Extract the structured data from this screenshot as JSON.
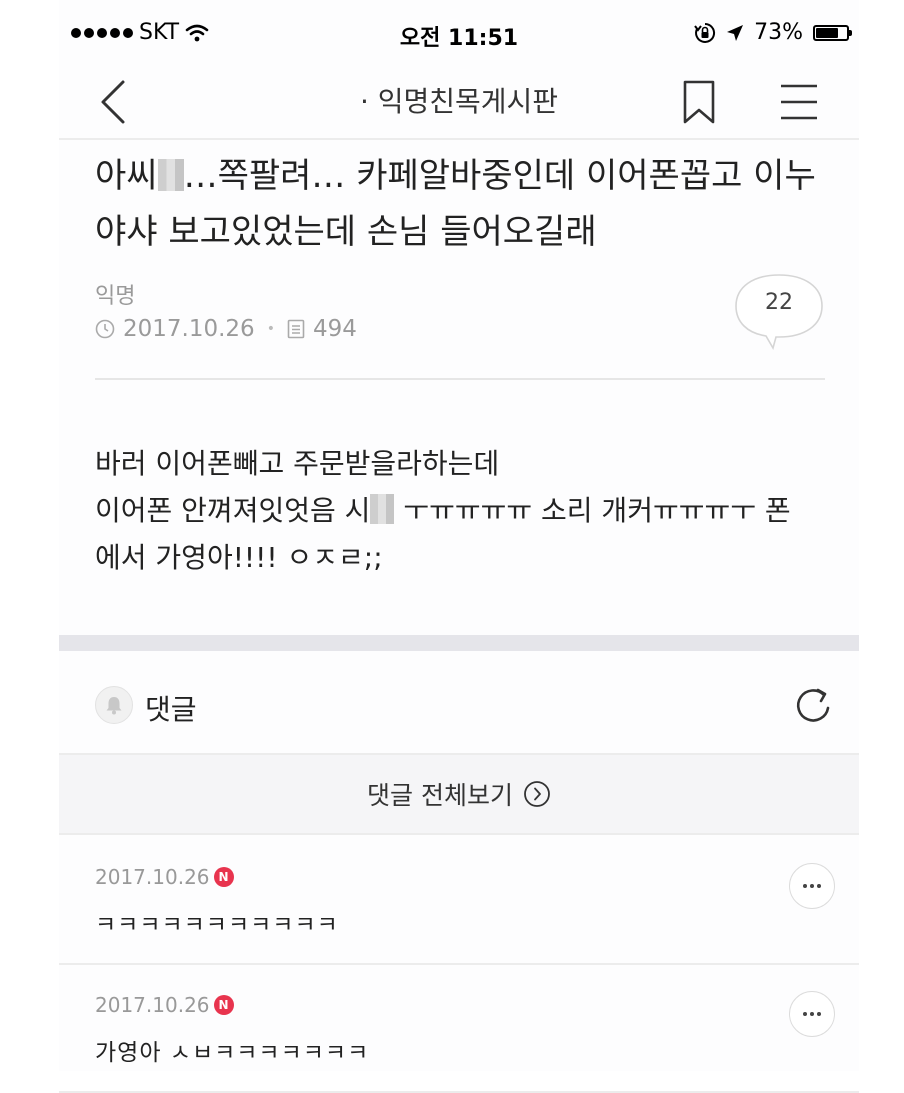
{
  "status_bar": {
    "carrier": "SKT",
    "time": "오전 11:51",
    "battery_percent": "73%",
    "battery_level": 0.73,
    "icons": [
      "signal-dots-icon",
      "wifi-icon",
      "orientation-lock-icon",
      "location-arrow-icon",
      "battery-icon"
    ]
  },
  "nav": {
    "title": "· 익명친목게시판",
    "back_icon": "chevron-left-icon",
    "bookmark_icon": "bookmark-icon",
    "menu_icon": "hamburger-menu-icon"
  },
  "post": {
    "title_part1": "아씨",
    "title_part2": "…쪽팔려… 카페알바중인데 이어폰꼽고 이누야샤 보고있었는데 손님 들어오길래",
    "author": "익명",
    "date": "2017.10.26",
    "views": "494",
    "comment_count": "22",
    "body_line1": "바러 이어폰빼고 주문받을라하는데",
    "body_line2a": "이어폰 안껴져잇엇음 시",
    "body_line2b": " ㅜㅠㅠㅠㅠ 소리 개커ㅠㅠㅠㅜ 폰",
    "body_line3": "에서 가영아!!!! ㅇㅈㄹ;;"
  },
  "comments_section": {
    "label": "댓글",
    "view_all_label": "댓글 전체보기",
    "items": [
      {
        "date": "2017.10.26",
        "badge": "N",
        "text": "ㅋㅋㅋㅋㅋㅋㅋㅋㅋㅋㅋ"
      },
      {
        "date": "2017.10.26",
        "badge": "N",
        "text": "가영아 ㅅㅂㅋㅋㅋㅋㅋㅋㅋ"
      }
    ]
  },
  "colors": {
    "accent_badge": "#e8344e",
    "band": "#e5e5ea",
    "muted_text": "#9a9a9a"
  }
}
